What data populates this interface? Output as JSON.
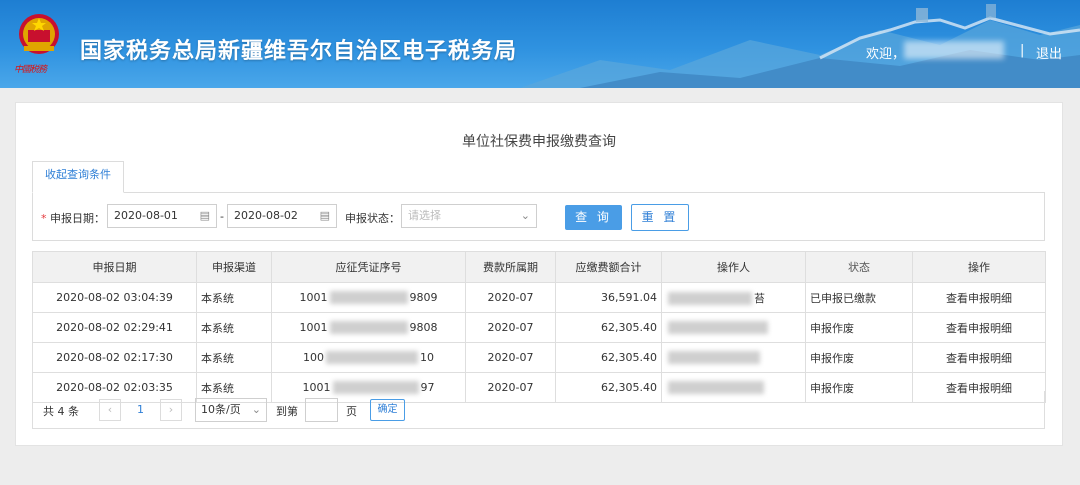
{
  "header": {
    "title": "国家税务总局新疆维吾尔自治区电子税务局",
    "emblem_caption": "中國税務",
    "welcome": "欢迎，",
    "separator": "|",
    "logout": "退出"
  },
  "page": {
    "title": "单位社保费申报缴费查询",
    "collapse_tab": "收起查询条件"
  },
  "query": {
    "date_label": "申报日期：",
    "required_mark": "*",
    "date_from": "2020-08-01",
    "date_to": "2020-08-02",
    "range_separator": "-",
    "status_label": "申报状态：",
    "status_placeholder": "请选择",
    "query_button": "查 询",
    "reset_button": "重 置"
  },
  "table": {
    "columns": [
      "申报日期",
      "申报渠道",
      "应征凭证序号",
      "费款所属期",
      "应缴费额合计",
      "操作人",
      "状态",
      "操作"
    ],
    "rows": [
      {
        "date": "2020-08-02 03:04:39",
        "channel": "本系统",
        "voucher_prefix": "1001",
        "voucher_suffix": "9809",
        "period": "2020-07",
        "amount": "36,591.04",
        "operator_suffix": "苔",
        "status": "已申报已缴款",
        "status_type": "green",
        "action": "查看申报明细"
      },
      {
        "date": "2020-08-02 02:29:41",
        "channel": "本系统",
        "voucher_prefix": "1001",
        "voucher_suffix": "9808",
        "period": "2020-07",
        "amount": "62,305.40",
        "operator_suffix": "",
        "status": "申报作废",
        "status_type": "gray",
        "action": "查看申报明细"
      },
      {
        "date": "2020-08-02 02:17:30",
        "channel": "本系统",
        "voucher_prefix": "100",
        "voucher_suffix": "10",
        "period": "2020-07",
        "amount": "62,305.40",
        "operator_suffix": "",
        "status": "申报作废",
        "status_type": "gray",
        "action": "查看申报明细"
      },
      {
        "date": "2020-08-02 02:03:35",
        "channel": "本系统",
        "voucher_prefix": "1001",
        "voucher_suffix": "97",
        "period": "2020-07",
        "amount": "62,305.40",
        "operator_suffix": "",
        "status": "申报作废",
        "status_type": "gray",
        "action": "查看申报明细"
      }
    ]
  },
  "pagination": {
    "total_prefix": "共",
    "total_count": "4",
    "total_suffix": "条",
    "prev": "‹",
    "current_page": "1",
    "next": "›",
    "page_size": "10条/页",
    "goto_label": "到第",
    "page_unit": "页",
    "confirm": "确定"
  },
  "colors": {
    "header_blue": "#2f92e0",
    "accent_blue": "#4a9de6",
    "link_blue": "#2f7fd6",
    "status_green": "#31b24a",
    "status_gray": "#aaaaaa"
  }
}
